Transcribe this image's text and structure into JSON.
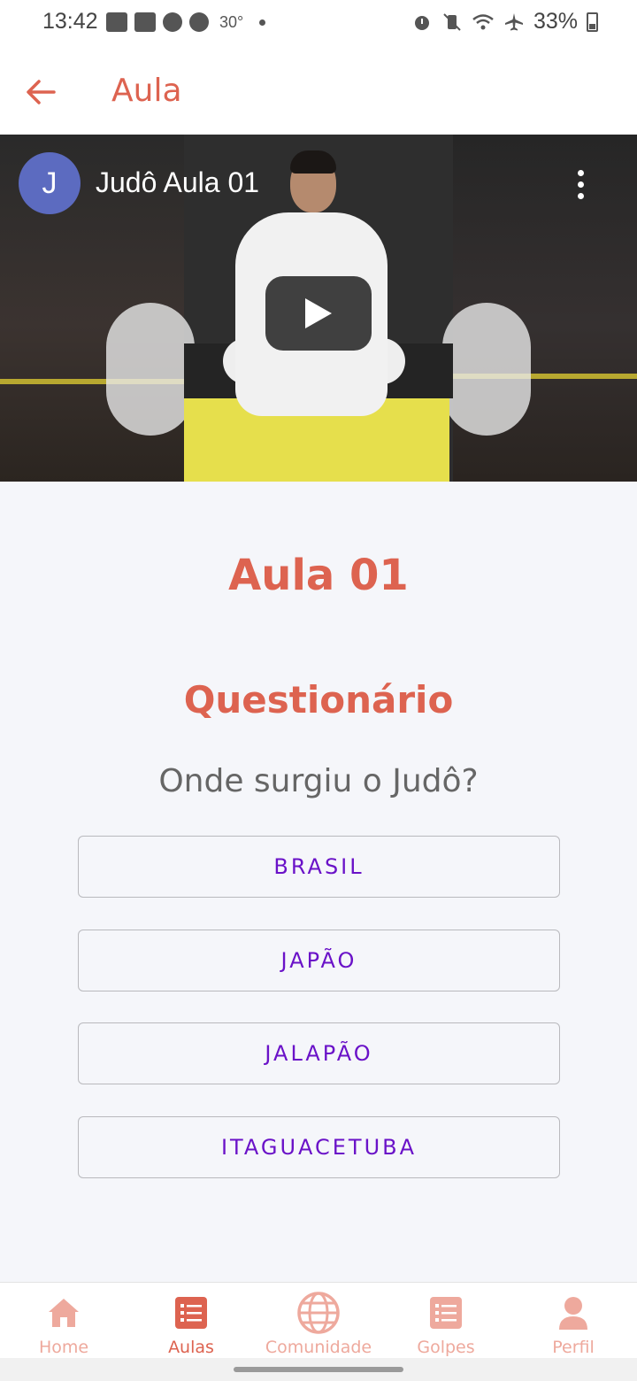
{
  "status_bar": {
    "time": "13:42",
    "temperature": "30°",
    "battery": "33%"
  },
  "app_bar": {
    "title": "Aula"
  },
  "video": {
    "channel_initial": "J",
    "title": "Judô Aula 01"
  },
  "lesson": {
    "title": "Aula 01",
    "quiz_heading": "Questionário",
    "question": "Onde surgiu o Judô?",
    "answers": [
      "BRASIL",
      "JAPÃO",
      "JALAPÃO",
      "ITAGUACETUBA"
    ]
  },
  "bottom_nav": {
    "items": [
      {
        "label": "Home",
        "icon": "home-icon"
      },
      {
        "label": "Aulas",
        "icon": "list-icon"
      },
      {
        "label": "Comunidade",
        "icon": "globe-icon"
      },
      {
        "label": "Golpes",
        "icon": "list-icon"
      },
      {
        "label": "Perfil",
        "icon": "person-icon"
      }
    ],
    "active_index": 1
  },
  "colors": {
    "accent": "#dd6350",
    "accent_light": "#eea99d",
    "answer_text": "#6a12c8"
  }
}
